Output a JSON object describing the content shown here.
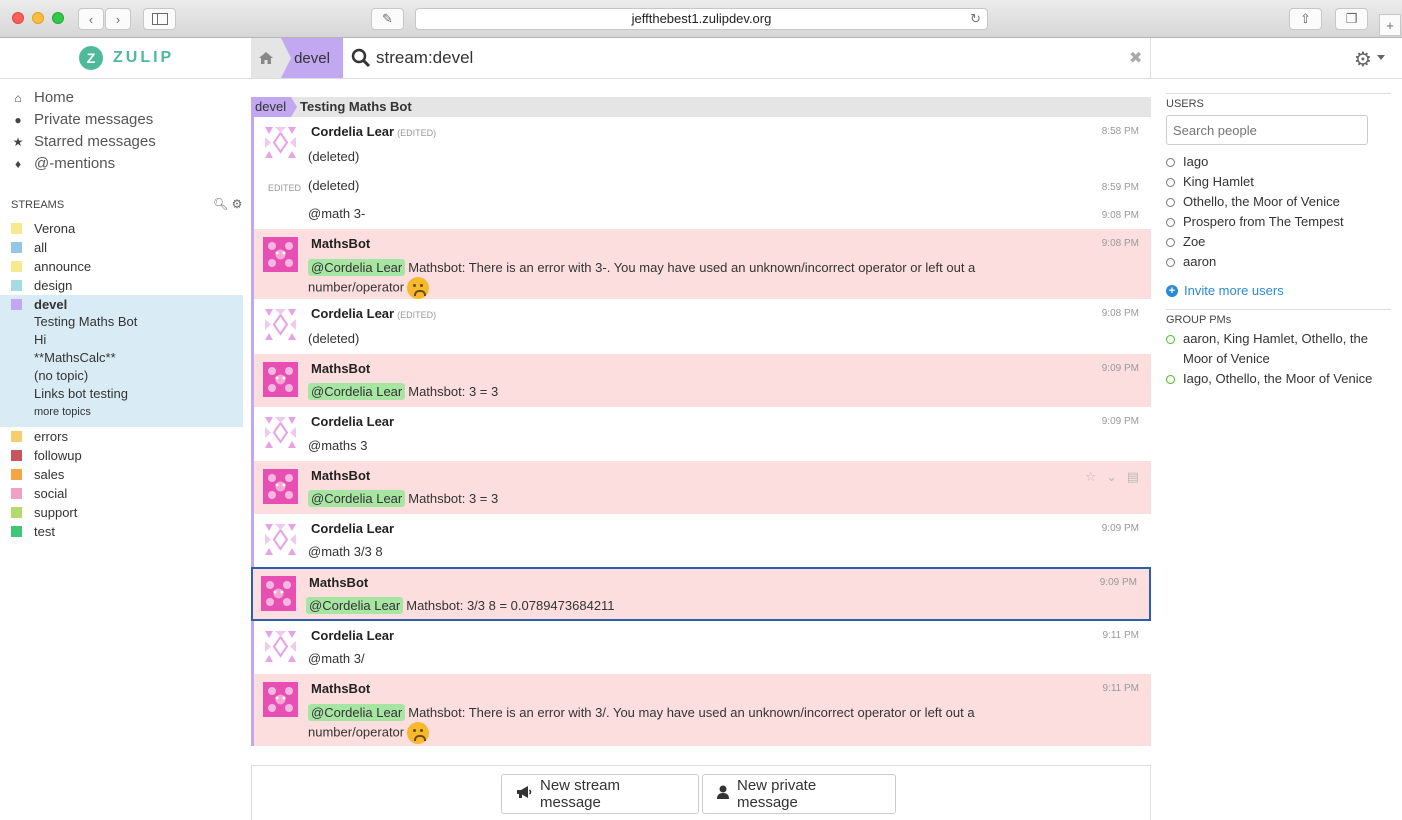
{
  "browser": {
    "url": "jeffthebest1.zulipdev.org"
  },
  "app": {
    "logo_text": "ZULIP",
    "logo_letter": "Z"
  },
  "narrow": {
    "stream": "devel",
    "search_query": "stream:devel"
  },
  "left_nav": {
    "items": [
      {
        "label": "Home",
        "icon": "home-icon"
      },
      {
        "label": "Private messages",
        "icon": "user-icon"
      },
      {
        "label": "Starred messages",
        "icon": "star-icon"
      },
      {
        "label": "@-mentions",
        "icon": "tag-icon"
      }
    ],
    "streams_header": "STREAMS",
    "streams": [
      {
        "name": "Verona",
        "color": "#f7e98e"
      },
      {
        "name": "all",
        "color": "#95c6e8"
      },
      {
        "name": "announce",
        "color": "#f7e98e"
      },
      {
        "name": "design",
        "color": "#a6dcdf"
      },
      {
        "name": "devel",
        "color": "#c2a8f0"
      },
      {
        "name": "errors",
        "color": "#f5ce6e"
      },
      {
        "name": "followup",
        "color": "#c8555a"
      },
      {
        "name": "sales",
        "color": "#f4a547"
      },
      {
        "name": "social",
        "color": "#f1a1c4"
      },
      {
        "name": "support",
        "color": "#b4d96c"
      },
      {
        "name": "test",
        "color": "#3ec778"
      }
    ],
    "devel_topics": [
      "Testing Maths Bot",
      "Hi",
      "**MathsCalc**",
      "(no topic)",
      "Links bot testing"
    ],
    "more_topics": "more topics"
  },
  "recipient": {
    "stream": "devel",
    "topic": "Testing Maths Bot"
  },
  "messages": [
    {
      "sender": "Cordelia Lear",
      "edited": "(EDITED)",
      "time": "8:58 PM",
      "text": "(deleted)"
    },
    {
      "edited_label": "EDITED",
      "time": "8:59 PM",
      "text": "(deleted)"
    },
    {
      "time": "9:08 PM",
      "text": "@math 3-"
    },
    {
      "sender": "MathsBot",
      "time": "9:08 PM",
      "mention": "@Cordelia Lear",
      "text": "Mathsbot: There is an error with 3-. You may have used an unknown/incorrect operator or left out a",
      "text2": "number/operator"
    },
    {
      "sender": "Cordelia Lear",
      "edited": "(EDITED)",
      "time": "9:08 PM",
      "text": "(deleted)"
    },
    {
      "sender": "MathsBot",
      "time": "9:09 PM",
      "mention": "@Cordelia Lear",
      "text": "Mathsbot: 3 = 3"
    },
    {
      "sender": "Cordelia Lear",
      "time": "9:09 PM",
      "text": "@maths 3"
    },
    {
      "sender": "MathsBot",
      "mention": "@Cordelia Lear",
      "text": "Mathsbot: 3 = 3"
    },
    {
      "sender": "Cordelia Lear",
      "time": "9:09 PM",
      "text": "@math 3/3 8"
    },
    {
      "sender": "MathsBot",
      "time": "9:09 PM",
      "mention": "@Cordelia Lear",
      "text": "Mathsbot: 3/3 8 = 0.0789473684211"
    },
    {
      "sender": "Cordelia Lear",
      "time": "9:11 PM",
      "text": "@math 3/"
    },
    {
      "sender": "MathsBot",
      "time": "9:11 PM",
      "mention": "@Cordelia Lear",
      "text": "Mathsbot: There is an error with 3/. You may have used an unknown/incorrect operator or left out a",
      "text2": "number/operator"
    }
  ],
  "compose": {
    "stream_button": "New stream message",
    "private_button": "New private message"
  },
  "right_sidebar": {
    "users_header": "USERS",
    "search_placeholder": "Search people",
    "users": [
      "Iago",
      "King Hamlet",
      "Othello, the Moor of Venice",
      "Prospero from The Tempest",
      "Zoe",
      "aaron"
    ],
    "invite_label": "Invite more users",
    "group_pms_header": "GROUP PMs",
    "group_pms": [
      "aaron, King Hamlet, Othello, the Moor of Venice",
      "Iago, Othello, the Moor of Venice"
    ]
  },
  "colors": {
    "stream_devel": "#c2a8f0",
    "bot_message_bg": "#fddede",
    "mention_bg": "#a7e5a3",
    "selected_border": "#2e5ea8",
    "brand": "#4fb99b"
  }
}
